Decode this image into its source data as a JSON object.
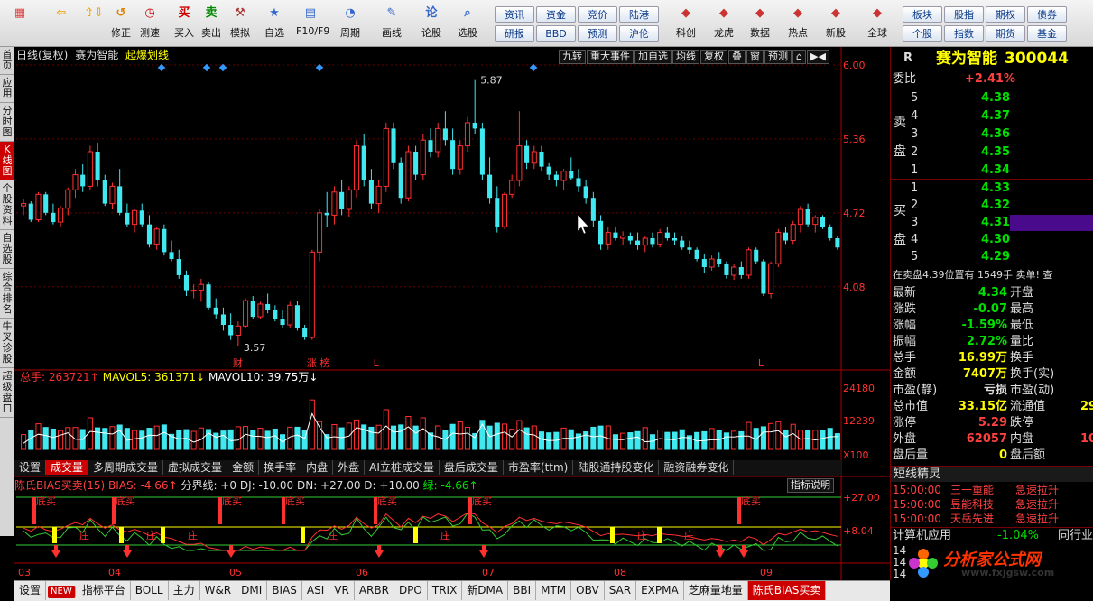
{
  "toolbar": {
    "items": [
      {
        "id": "grid",
        "label": "",
        "glyph": "▦",
        "color": "#e04040"
      },
      {
        "id": "back",
        "label": "",
        "glyph": "⇦",
        "color": "#f0a000"
      },
      {
        "id": "up",
        "label": "",
        "glyph": "⇧⇩",
        "color": "#f0a000"
      },
      {
        "id": "revise",
        "label": "修正",
        "glyph": "↺",
        "color": "#e08000"
      },
      {
        "id": "speed",
        "label": "测速",
        "glyph": "◷",
        "color": "#c00"
      },
      {
        "id": "buy",
        "label": "买入",
        "glyph": "买",
        "color": "#c00"
      },
      {
        "id": "sell",
        "label": "卖出",
        "glyph": "卖",
        "color": "#080"
      },
      {
        "id": "sim",
        "label": "模拟",
        "glyph": "⚒",
        "color": "#a33"
      },
      {
        "id": "watch",
        "label": "自选",
        "glyph": "★",
        "color": "#36c"
      },
      {
        "id": "f10",
        "label": "F10/F9",
        "glyph": "▤",
        "color": "#36c"
      },
      {
        "id": "period",
        "label": "周期",
        "glyph": "◔",
        "color": "#36c"
      },
      {
        "id": "draw",
        "label": "画线",
        "glyph": "✎",
        "color": "#36c"
      },
      {
        "id": "lungu",
        "label": "论股",
        "glyph": "论",
        "color": "#36c"
      },
      {
        "id": "pick",
        "label": "选股",
        "glyph": "⌕",
        "color": "#36c"
      }
    ],
    "groups": [
      [
        "资讯",
        "资金",
        "竞价",
        "陆港"
      ],
      [
        "研报",
        "BBD",
        "预测",
        "沪伦"
      ]
    ],
    "items2": [
      {
        "id": "kechuang",
        "label": "科创"
      },
      {
        "id": "longhu",
        "label": "龙虎"
      },
      {
        "id": "data",
        "label": "数据"
      },
      {
        "id": "hot",
        "label": "热点"
      },
      {
        "id": "newstock",
        "label": "新股"
      },
      {
        "id": "global",
        "label": "全球"
      }
    ],
    "groups2": [
      [
        "板块",
        "股指",
        "期权",
        "债券"
      ],
      [
        "个股",
        "指数",
        "期货",
        "基金"
      ]
    ]
  },
  "lefttabs": [
    "首页",
    "应用",
    "分时图",
    "K线图",
    "个股资料",
    "自选股",
    "综合排名",
    "牛叉诊股",
    "超级盘口"
  ],
  "chart_header": {
    "left": "日线(复权)",
    "name": "赛为智能",
    "signal": "起爆划线",
    "buttons": [
      "九转",
      "重大事件",
      "加自选",
      "均线",
      "复权",
      "叠",
      "窗",
      "预测",
      "⌂",
      "▶◀"
    ]
  },
  "chart_data": {
    "type": "candlestick",
    "title": "赛为智能",
    "price_axis": [
      "6.00",
      "5.36",
      "4.72",
      "4.08"
    ],
    "price_range": [
      3.5,
      6.0
    ],
    "annotations": [
      {
        "text": "5.87"
      },
      {
        "text": "3.57"
      },
      {
        "text": "财"
      },
      {
        "text": "L"
      },
      {
        "text": "涨 榜"
      },
      {
        "text": "L"
      }
    ],
    "month_labels": [
      "03",
      "04",
      "05",
      "06",
      "07",
      "08",
      "09"
    ],
    "candles": [
      [
        4.78,
        4.84,
        4.7,
        4.8
      ],
      [
        4.8,
        4.82,
        4.64,
        4.66
      ],
      [
        4.66,
        4.9,
        4.64,
        4.88
      ],
      [
        4.88,
        4.9,
        4.7,
        4.72
      ],
      [
        4.72,
        4.8,
        4.62,
        4.64
      ],
      [
        4.64,
        4.78,
        4.6,
        4.76
      ],
      [
        4.76,
        4.94,
        4.7,
        4.92
      ],
      [
        4.92,
        5.1,
        4.85,
        5.05
      ],
      [
        5.05,
        5.14,
        4.9,
        4.95
      ],
      [
        4.95,
        5.3,
        4.92,
        5.25
      ],
      [
        5.25,
        5.32,
        4.95,
        5.0
      ],
      [
        5.0,
        5.05,
        4.78,
        4.8
      ],
      [
        4.8,
        4.98,
        4.75,
        4.95
      ],
      [
        4.95,
        5.1,
        4.7,
        4.72
      ],
      [
        4.72,
        4.8,
        4.6,
        4.62
      ],
      [
        4.62,
        4.75,
        4.55,
        4.74
      ],
      [
        4.74,
        4.8,
        4.6,
        4.62
      ],
      [
        4.62,
        4.7,
        4.42,
        4.45
      ],
      [
        4.45,
        4.6,
        4.4,
        4.58
      ],
      [
        4.58,
        4.62,
        4.35,
        4.38
      ],
      [
        4.38,
        4.48,
        4.3,
        4.32
      ],
      [
        4.32,
        4.4,
        4.15,
        4.18
      ],
      [
        4.18,
        4.22,
        4.0,
        4.05
      ],
      [
        4.05,
        4.1,
        3.98,
        4.05
      ],
      [
        4.05,
        4.15,
        3.95,
        4.1
      ],
      [
        4.1,
        4.12,
        3.88,
        3.9
      ],
      [
        3.9,
        3.98,
        3.8,
        3.84
      ],
      [
        3.84,
        3.9,
        3.7,
        3.75
      ],
      [
        3.75,
        3.85,
        3.62,
        3.66
      ],
      [
        3.66,
        3.78,
        3.57,
        3.74
      ],
      [
        3.74,
        3.98,
        3.72,
        3.96
      ],
      [
        3.96,
        4.0,
        3.8,
        3.82
      ],
      [
        3.82,
        3.95,
        3.8,
        3.93
      ],
      [
        3.93,
        4.02,
        3.85,
        3.88
      ],
      [
        3.88,
        3.92,
        3.78,
        3.8
      ],
      [
        3.8,
        3.88,
        3.72,
        3.75
      ],
      [
        3.75,
        3.95,
        3.72,
        3.92
      ],
      [
        3.92,
        3.96,
        3.7,
        3.72
      ],
      [
        3.72,
        3.75,
        3.62,
        3.64
      ],
      [
        3.64,
        4.4,
        3.62,
        4.38
      ],
      [
        4.38,
        4.75,
        4.3,
        4.72
      ],
      [
        4.72,
        4.9,
        4.6,
        4.7
      ],
      [
        4.7,
        4.95,
        4.62,
        4.9
      ],
      [
        4.9,
        5.0,
        4.7,
        4.75
      ],
      [
        4.75,
        4.95,
        4.68,
        4.92
      ],
      [
        4.92,
        5.35,
        4.85,
        5.3
      ],
      [
        5.3,
        5.4,
        4.95,
        5.0
      ],
      [
        5.0,
        5.1,
        4.75,
        4.8
      ],
      [
        4.8,
        5.0,
        4.72,
        4.95
      ],
      [
        4.95,
        5.5,
        4.9,
        5.45
      ],
      [
        5.45,
        5.5,
        5.1,
        5.15
      ],
      [
        5.15,
        5.2,
        4.8,
        4.85
      ],
      [
        4.85,
        5.3,
        4.82,
        5.25
      ],
      [
        5.25,
        5.3,
        5.0,
        5.05
      ],
      [
        5.05,
        5.4,
        5.0,
        5.35
      ],
      [
        5.35,
        5.45,
        5.2,
        5.25
      ],
      [
        5.25,
        5.5,
        5.2,
        5.45
      ],
      [
        5.45,
        5.6,
        5.3,
        5.35
      ],
      [
        5.35,
        5.45,
        5.05,
        5.1
      ],
      [
        5.1,
        5.35,
        5.05,
        5.3
      ],
      [
        5.3,
        5.55,
        5.25,
        5.5
      ],
      [
        5.5,
        5.87,
        5.4,
        5.45
      ],
      [
        5.45,
        5.5,
        5.0,
        5.05
      ],
      [
        5.05,
        5.2,
        4.8,
        4.85
      ],
      [
        4.85,
        4.95,
        4.55,
        4.6
      ],
      [
        4.6,
        4.9,
        4.58,
        4.88
      ],
      [
        4.88,
        5.05,
        4.85,
        5.0
      ],
      [
        5.0,
        5.6,
        4.95,
        5.3
      ],
      [
        5.3,
        5.35,
        5.1,
        5.15
      ],
      [
        5.15,
        5.3,
        5.1,
        5.25
      ],
      [
        5.25,
        5.3,
        5.08,
        5.12
      ],
      [
        5.12,
        5.15,
        5.0,
        5.05
      ],
      [
        5.05,
        5.08,
        4.95,
        5.0
      ],
      [
        5.0,
        5.1,
        4.92,
        5.08
      ],
      [
        5.08,
        5.2,
        5.0,
        5.02
      ],
      [
        5.02,
        5.1,
        4.9,
        4.95
      ],
      [
        4.95,
        5.0,
        4.8,
        4.85
      ],
      [
        4.85,
        4.9,
        4.6,
        4.65
      ],
      [
        4.65,
        4.7,
        4.4,
        4.45
      ],
      [
        4.45,
        4.6,
        4.4,
        4.55
      ],
      [
        4.55,
        4.6,
        4.48,
        4.5
      ],
      [
        4.5,
        4.56,
        4.44,
        4.52
      ],
      [
        4.52,
        4.55,
        4.45,
        4.48
      ],
      [
        4.48,
        4.55,
        4.4,
        4.44
      ],
      [
        4.44,
        4.52,
        4.38,
        4.5
      ],
      [
        4.5,
        4.55,
        4.42,
        4.45
      ],
      [
        4.45,
        4.58,
        4.42,
        4.55
      ],
      [
        4.55,
        4.6,
        4.48,
        4.5
      ],
      [
        4.5,
        4.55,
        4.44,
        4.48
      ],
      [
        4.48,
        4.52,
        4.4,
        4.42
      ],
      [
        4.42,
        4.48,
        4.36,
        4.4
      ],
      [
        4.4,
        4.42,
        4.3,
        4.32
      ],
      [
        4.32,
        4.36,
        4.2,
        4.25
      ],
      [
        4.25,
        4.35,
        4.22,
        4.32
      ],
      [
        4.32,
        4.38,
        4.25,
        4.28
      ],
      [
        4.28,
        4.3,
        4.15,
        4.18
      ],
      [
        4.18,
        4.28,
        4.14,
        4.25
      ],
      [
        4.25,
        4.3,
        4.15,
        4.18
      ],
      [
        4.18,
        4.42,
        4.15,
        4.4
      ],
      [
        4.4,
        4.42,
        4.28,
        4.3
      ],
      [
        4.3,
        4.32,
        4.0,
        4.02
      ],
      [
        4.02,
        4.3,
        3.98,
        4.28
      ],
      [
        4.28,
        4.58,
        4.25,
        4.55
      ],
      [
        4.55,
        4.6,
        4.45,
        4.48
      ],
      [
        4.48,
        4.65,
        4.45,
        4.62
      ],
      [
        4.62,
        4.78,
        4.55,
        4.75
      ],
      [
        4.75,
        4.8,
        4.6,
        4.62
      ],
      [
        4.62,
        4.7,
        4.55,
        4.68
      ],
      [
        4.68,
        4.7,
        4.58,
        4.6
      ],
      [
        4.6,
        4.62,
        4.48,
        4.5
      ],
      [
        4.5,
        4.52,
        4.4,
        4.42
      ]
    ],
    "volume_axis": [
      "24180",
      "12239",
      "X100"
    ],
    "volume_header": {
      "total": "总手: 263721↑",
      "mavol5": "MAVOL5: 361371↓",
      "mavol10": "MAVOL10: 39.75万↓"
    },
    "volume_tabs": [
      "设置",
      "成交量",
      "多周期成交量",
      "虚拟成交量",
      "金额",
      "换手率",
      "内盘",
      "外盘",
      "AI立桩成交量",
      "盘后成交量",
      "市盈率(ttm)",
      "陆股通持股变化",
      "融资融券变化"
    ],
    "indicator_header": {
      "name": "陈氏BIAS买卖(15) BIAS: -4.66↑",
      "fenjie": "分界线: +0",
      "dj": "DJ: -10.00",
      "dn": "DN: +27.00",
      "d": "D: +10.00",
      "green": "绿: -4.66↑",
      "desc": "指标说明"
    },
    "indicator_axis": [
      "+27.00",
      "+8.04"
    ],
    "indicator_labels": [
      "底买",
      "底买",
      "底买",
      "底买",
      "底买",
      "底买",
      "底买",
      "庄",
      "庄",
      "庄",
      "庄",
      "庄",
      "庄",
      "庄"
    ]
  },
  "quote": {
    "r": "R",
    "name": "赛为智能",
    "code": "300044",
    "weibi_label": "委比",
    "weibi": "+2.41%",
    "sell_label": "卖\n盘",
    "buy_label": "买\n盘",
    "sells": [
      {
        "n": "5",
        "p": "4.38"
      },
      {
        "n": "4",
        "p": "4.37"
      },
      {
        "n": "3",
        "p": "4.36"
      },
      {
        "n": "2",
        "p": "4.35"
      },
      {
        "n": "1",
        "p": "4.34"
      }
    ],
    "buys": [
      {
        "n": "1",
        "p": "4.33"
      },
      {
        "n": "2",
        "p": "4.32"
      },
      {
        "n": "3",
        "p": "4.31"
      },
      {
        "n": "4",
        "p": "4.30"
      },
      {
        "n": "5",
        "p": "4.29"
      }
    ],
    "notice": "在卖盘4.39位置有   1549手  卖单!   查",
    "fields": [
      {
        "l": "最新",
        "v": "4.34",
        "c": "green",
        "r": "开盘"
      },
      {
        "l": "涨跌",
        "v": "-0.07",
        "c": "green",
        "r": "最高"
      },
      {
        "l": "涨幅",
        "v": "-1.59%",
        "c": "green",
        "r": "最低"
      },
      {
        "l": "振幅",
        "v": "2.72%",
        "c": "green",
        "r": "量比"
      },
      {
        "l": "总手",
        "v": "16.99万",
        "c": "yellow",
        "r": "换手"
      },
      {
        "l": "金额",
        "v": "7407万",
        "c": "yellow",
        "r": "换手(实)"
      },
      {
        "l": "市盈(静)",
        "v": "亏损",
        "c": "white",
        "r": "市盈(动)"
      },
      {
        "l": "总市值",
        "v": "33.15亿",
        "c": "yellow",
        "r": "流通值",
        "rv": "29"
      },
      {
        "l": "涨停",
        "v": "5.29",
        "c": "red",
        "r": "跌停"
      },
      {
        "l": "外盘",
        "v": "62057",
        "c": "red",
        "r": "内盘",
        "rv": "10"
      },
      {
        "l": "盘后量",
        "v": "0",
        "c": "yellow",
        "r": "盘后额"
      }
    ],
    "short_title": "短线精灵",
    "short": [
      {
        "t": "15:00:00",
        "n": "三一重能",
        "a": "急速拉升"
      },
      {
        "t": "15:00:00",
        "n": "昱能科技",
        "a": "急速拉升"
      },
      {
        "t": "15:00:00",
        "n": "天岳先进",
        "a": "急速拉升"
      }
    ],
    "app_row": {
      "l": "计算机应用",
      "v": "-1.04%",
      "r": "同行业"
    },
    "extra": [
      "14",
      "14",
      "14"
    ],
    "watermark": "分析家公式网",
    "watermark_url": "www.fxjgsw.com"
  },
  "bottom_tabs": [
    "设置",
    "NEW",
    "指标平台",
    "BOLL",
    "主力",
    "W&R",
    "DMI",
    "BIAS",
    "ASI",
    "VR",
    "ARBR",
    "DPO",
    "TRIX",
    "新DMA",
    "BBI",
    "MTM",
    "OBV",
    "SAR",
    "EXPMA",
    "芝麻量地量",
    "陈氏BIAS买卖"
  ]
}
